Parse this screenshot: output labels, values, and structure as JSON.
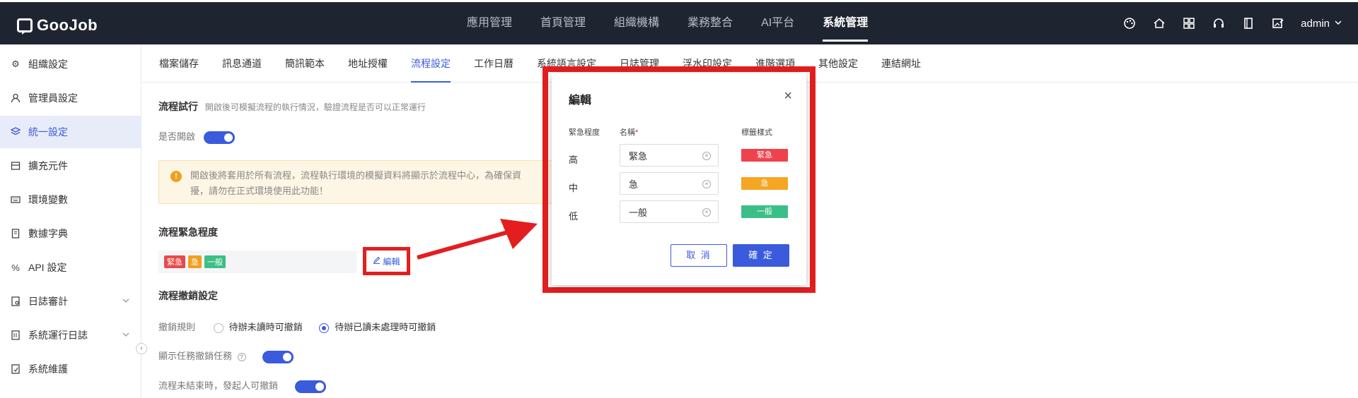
{
  "app": {
    "logo_text": "GooJob"
  },
  "top_menu": [
    {
      "label": "應用管理",
      "active": false
    },
    {
      "label": "首頁管理",
      "active": false
    },
    {
      "label": "組織機構",
      "active": false
    },
    {
      "label": "業務整合",
      "active": false
    },
    {
      "label": "AI平台",
      "active": false
    },
    {
      "label": "系統管理",
      "active": true
    }
  ],
  "top_tools": {
    "user": "admin"
  },
  "sidebar": {
    "items": [
      {
        "label": "組織設定",
        "icon": "gear-icon"
      },
      {
        "label": "管理員設定",
        "icon": "user-icon"
      },
      {
        "label": "統一設定",
        "icon": "stack-icon",
        "active": true
      },
      {
        "label": "擴充元件",
        "icon": "box-icon"
      },
      {
        "label": "環境變數",
        "icon": "keyboard-icon"
      },
      {
        "label": "數據字典",
        "icon": "book-icon"
      },
      {
        "label": "API 設定",
        "icon": "api-icon"
      },
      {
        "label": "日誌審計",
        "icon": "log-icon",
        "expandable": true
      },
      {
        "label": "系統運行日誌",
        "icon": "log-run-icon",
        "expandable": true
      },
      {
        "label": "系統維護",
        "icon": "maintenance-icon"
      }
    ]
  },
  "subtabs": [
    {
      "label": "檔案儲存"
    },
    {
      "label": "訊息通道"
    },
    {
      "label": "簡訊範本"
    },
    {
      "label": "地址授權"
    },
    {
      "label": "流程設定",
      "active": true
    },
    {
      "label": "工作日曆"
    },
    {
      "label": "系統語言設定"
    },
    {
      "label": "日誌管理"
    },
    {
      "label": "浮水印設定"
    },
    {
      "label": "進階選項"
    },
    {
      "label": "其他設定"
    },
    {
      "label": "連結網址"
    }
  ],
  "content": {
    "trial_run": {
      "title": "流程試行",
      "desc": "開啟後可模擬流程的執行情況，驗證流程是否可以正常運行",
      "enable_label": "是否開啟",
      "warning_line1": "開啟後將套用於所有流程，流程執行環境的模擬資料將顯示於流程中心，為確保資",
      "warning_line2": "擾，請勿在正式環境使用此功能！"
    },
    "urgency": {
      "title": "流程緊急程度",
      "tags": [
        {
          "label": "緊急",
          "color": "#e84a4a"
        },
        {
          "label": "急",
          "color": "#f0a020"
        },
        {
          "label": "一般",
          "color": "#3dbf86"
        }
      ],
      "edit_label": "編輯"
    },
    "revoke": {
      "title": "流程撤銷設定",
      "rule_label": "撤銷規則",
      "option1": "待辦未讀時可撤銷",
      "option2": "待辦已讀未處理時可撤銷",
      "show_task_label": "顯示任務撤銷任務",
      "initiator_label": "流程未結束時，發起人可撤銷"
    }
  },
  "modal": {
    "title": "編輯",
    "col_level": "緊急程度",
    "col_name": "名稱",
    "col_style": "標籤樣式",
    "rows": [
      {
        "level": "高",
        "name": "緊急",
        "tag": "緊急",
        "color": "#f0424d"
      },
      {
        "level": "中",
        "name": "急",
        "tag": "急",
        "color": "#f5a623"
      },
      {
        "level": "低",
        "name": "一般",
        "tag": "一般",
        "color": "#3bbf88"
      }
    ],
    "cancel": "取 消",
    "confirm": "確 定"
  }
}
